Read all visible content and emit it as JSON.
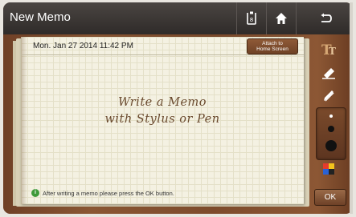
{
  "header": {
    "title": "New Memo",
    "buttons": [
      {
        "name": "memo-list-icon"
      },
      {
        "name": "home-icon"
      },
      {
        "name": "back-icon"
      }
    ]
  },
  "memo": {
    "date": "Mon. Jan 27 2014 11:42 PM",
    "attach_line1": "Attach to",
    "attach_line2": "Home Screen",
    "hint_line1": "Write a Memo",
    "hint_line2": "with Stylus or Pen",
    "notice": "After writing a memo please press the OK button."
  },
  "tools": [
    {
      "name": "text-tool-icon"
    },
    {
      "name": "eraser-icon"
    },
    {
      "name": "pen-icon"
    },
    {
      "name": "color-palette-icon"
    }
  ],
  "pen_sizes": [
    "small",
    "medium",
    "large"
  ],
  "ok_label": "OK",
  "colors": {
    "titlebar": "#2f2b29",
    "leather": "#7d4b2c",
    "paper": "#f4f1e2",
    "hint_text": "#6a4a2e",
    "info_green": "#3e9a3a"
  }
}
